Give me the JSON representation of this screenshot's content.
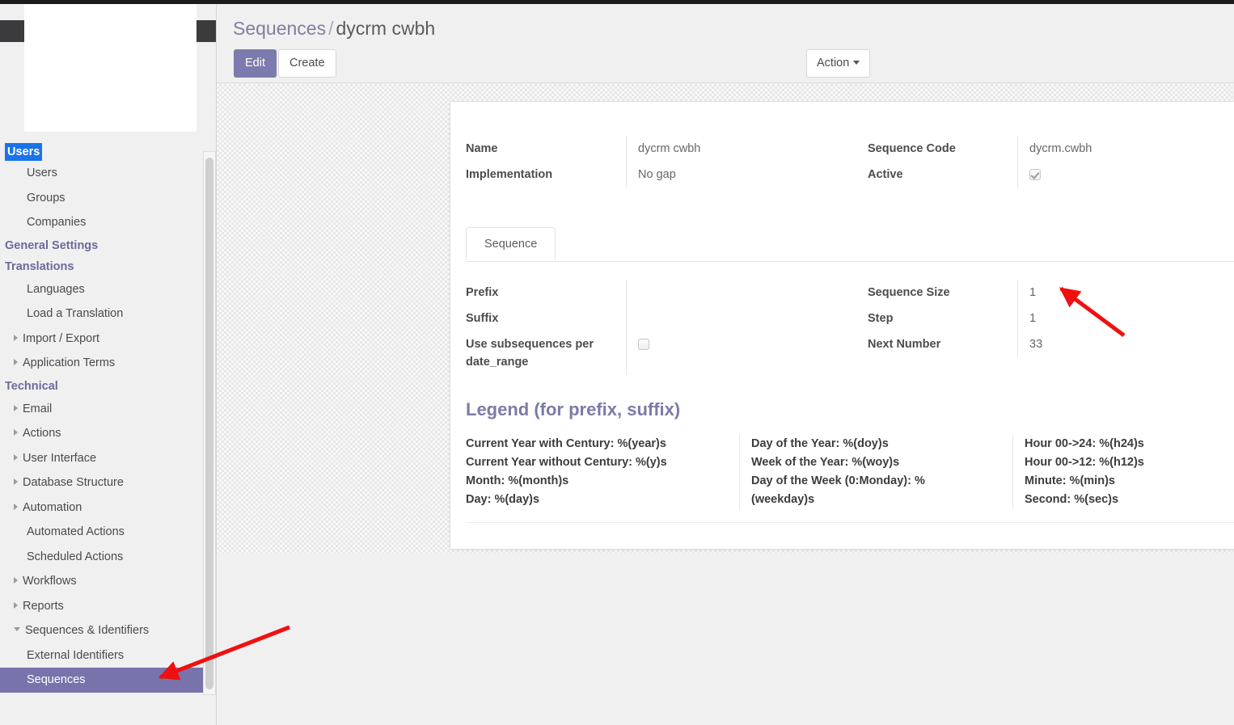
{
  "window": {
    "title": "Sequences / dycrm cwbh"
  },
  "sidebar": {
    "sections": [
      {
        "label": "Users",
        "selected": true
      },
      {
        "label": "General Settings",
        "selected": false
      },
      {
        "label": "Translations",
        "selected": false
      },
      {
        "label": "Technical",
        "selected": false
      }
    ],
    "items": [
      {
        "label": "Users",
        "caret": "none",
        "indent": true
      },
      {
        "label": "Groups",
        "caret": "none",
        "indent": true
      },
      {
        "label": "Companies",
        "caret": "none",
        "indent": true
      },
      {
        "label": "Languages",
        "caret": "none",
        "indent": true
      },
      {
        "label": "Load a Translation",
        "caret": "none",
        "indent": true
      },
      {
        "label": "Import / Export",
        "caret": "right",
        "indent": false
      },
      {
        "label": "Application Terms",
        "caret": "right",
        "indent": false
      },
      {
        "label": "Email",
        "caret": "right",
        "indent": false
      },
      {
        "label": "Actions",
        "caret": "right",
        "indent": false
      },
      {
        "label": "User Interface",
        "caret": "right",
        "indent": false
      },
      {
        "label": "Database Structure",
        "caret": "right",
        "indent": false
      },
      {
        "label": "Automation",
        "caret": "right",
        "indent": false
      },
      {
        "label": "Automated Actions",
        "caret": "none",
        "indent": true
      },
      {
        "label": "Scheduled Actions",
        "caret": "none",
        "indent": true
      },
      {
        "label": "Workflows",
        "caret": "right",
        "indent": false
      },
      {
        "label": "Reports",
        "caret": "right",
        "indent": false
      },
      {
        "label": "Sequences & Identifiers",
        "caret": "down",
        "indent": false
      },
      {
        "label": "External Identifiers",
        "caret": "none",
        "indent": true
      },
      {
        "label": "Sequences",
        "caret": "none",
        "indent": true,
        "active": true
      }
    ]
  },
  "breadcrumb": {
    "root": "Sequences",
    "separator": "/",
    "current": "dycrm cwbh"
  },
  "toolbar": {
    "edit_label": "Edit",
    "create_label": "Create",
    "action_label": "Action"
  },
  "form": {
    "left": [
      {
        "label": "Name",
        "value": "dycrm cwbh"
      },
      {
        "label": "Implementation",
        "value": "No gap"
      }
    ],
    "right": [
      {
        "label": "Sequence Code",
        "value": "dycrm.cwbh"
      },
      {
        "label": "Active",
        "value": "",
        "checkbox": true,
        "checked": true
      }
    ]
  },
  "notebook": {
    "tabs": [
      {
        "label": "Sequence",
        "active": true
      }
    ]
  },
  "sequence_tab": {
    "left": [
      {
        "label": "Prefix",
        "value": ""
      },
      {
        "label": "Suffix",
        "value": ""
      },
      {
        "label": "Use subsequences per date_range",
        "value": "",
        "checkbox": true,
        "checked": false
      }
    ],
    "right": [
      {
        "label": "Sequence Size",
        "value": "1"
      },
      {
        "label": "Step",
        "value": "1"
      },
      {
        "label": "Next Number",
        "value": "33"
      }
    ]
  },
  "legend": {
    "title": "Legend (for prefix, suffix)",
    "columns": [
      [
        "Current Year with Century: %(year)s",
        "Current Year without Century: %(y)s",
        "Month: %(month)s",
        "Day: %(day)s"
      ],
      [
        "Day of the Year: %(doy)s",
        "Week of the Year: %(woy)s",
        "Day of the Week (0:Monday): %(weekday)s"
      ],
      [
        "Hour 00->24: %(h24)s",
        "Hour 00->12: %(h12)s",
        "Minute: %(min)s",
        "Second: %(sec)s"
      ]
    ]
  },
  "annotations": {
    "arrow_color": "#f01010",
    "arrows": [
      {
        "name": "arrow-to-sequence-size",
        "points_to": "Sequence Size value"
      },
      {
        "name": "arrow-to-sequences-menu",
        "points_to": "Sequences menu item"
      }
    ]
  },
  "colors": {
    "accent_purple": "#7c7bad",
    "selection_blue": "#1a73e8",
    "menu_active": "#7874ab",
    "arrow_red": "#f01010"
  }
}
